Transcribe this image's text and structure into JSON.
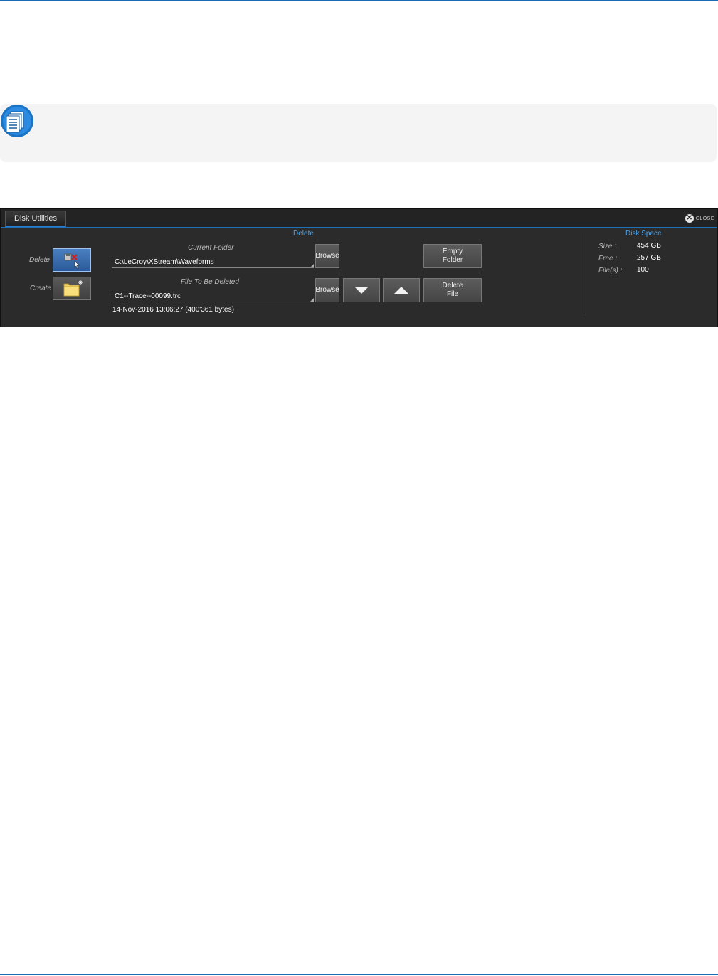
{
  "window": {
    "tab_label": "Disk Utilities",
    "close_label": "CLOSE"
  },
  "tools": {
    "delete_label": "Delete",
    "create_label": "Create"
  },
  "delete_section": {
    "title": "Delete",
    "current_folder_label": "Current Folder",
    "current_folder_value": "C:\\LeCroy\\XStream\\Waveforms",
    "file_label": "File To Be Deleted",
    "file_value": "C1--Trace--00099.trc",
    "file_info": "14-Nov-2016 13:06:27 (400'361 bytes)",
    "browse_label": "Browse",
    "empty_folder_label": "Empty\nFolder",
    "delete_file_label": "Delete\nFile"
  },
  "disk_space": {
    "title": "Disk Space",
    "size_label": "Size :",
    "size_value": "454 GB",
    "free_label": "Free :",
    "free_value": "257 GB",
    "files_label": "File(s) :",
    "files_value": "100"
  },
  "icons": {
    "note": "document-note-icon",
    "delete_tool": "disk-delete-icon",
    "create_tool": "new-folder-icon",
    "close": "close-circle-icon"
  }
}
